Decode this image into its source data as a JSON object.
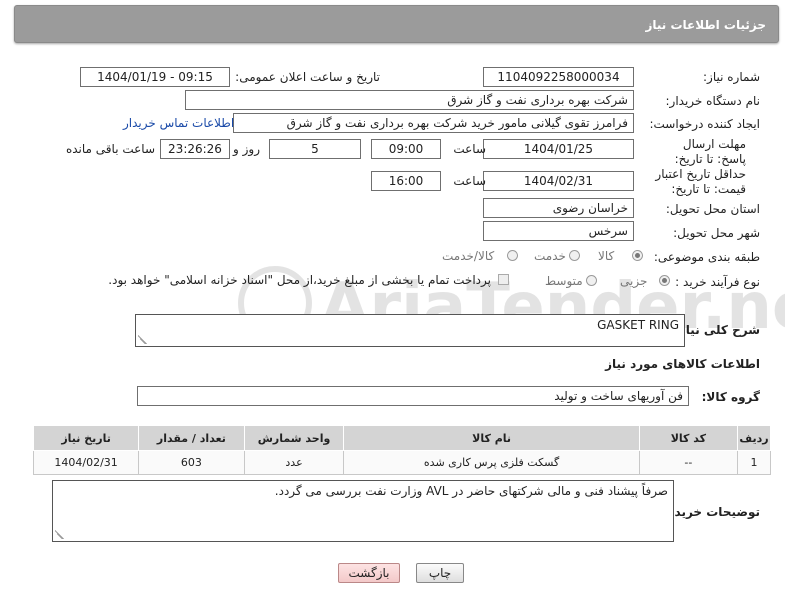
{
  "header": {
    "title": "جزئیات اطلاعات نیاز"
  },
  "form": {
    "need_number": {
      "label": "شماره نیاز:",
      "value": "1104092258000034"
    },
    "announce_datetime": {
      "label": "تاریخ و ساعت اعلان عمومی:",
      "value": "1404/01/19 - 09:15"
    },
    "buyer_org": {
      "label": "نام دستگاه خریدار:",
      "value": "شرکت بهره برداری نفت و گاز شرق"
    },
    "requester": {
      "label": "ایجاد کننده درخواست:",
      "value": "فرامرز تقوی گیلانی مامور خرید شرکت بهره برداری نفت و گاز شرق",
      "contact_link": "اطلاعات تماس خریدار"
    },
    "reply_deadline": {
      "label": "مهلت ارسال پاسخ: تا تاریخ:",
      "date": "1404/01/25",
      "time_label": "ساعت",
      "time": "09:00",
      "days": "5",
      "days_label": "روز و",
      "remaining": "23:26:26",
      "remaining_label": "ساعت باقی مانده"
    },
    "price_validity": {
      "label": "حداقل تاریخ اعتبار قیمت: تا تاریخ:",
      "date": "1404/02/31",
      "time_label": "ساعت",
      "time": "16:00"
    },
    "delivery_province": {
      "label": "استان محل تحویل:",
      "value": "خراسان رضوی"
    },
    "delivery_city": {
      "label": "شهر محل تحویل:",
      "value": "سرخس"
    },
    "category": {
      "label": "طبقه بندی موضوعی:",
      "options": [
        "کالا",
        "خدمت",
        "کالا/خدمت"
      ],
      "selected": "کالا"
    },
    "process_type": {
      "label": "نوع فرآیند خرید :",
      "options": [
        "جزیی",
        "متوسط"
      ],
      "selected": "جزیی",
      "payment_note": "پرداخت تمام یا بخشی از مبلغ خرید،از محل \"اسناد خزانه اسلامی\" خواهد بود."
    },
    "description": {
      "label": "شرح کلی نیاز:",
      "value": "GASKET RING"
    }
  },
  "items_section": {
    "title": "اطلاعات کالاهای مورد نیاز",
    "group_label": "گروه کالا:",
    "group_value": "فن آوریهای ساخت و تولید",
    "columns": [
      "ردیف",
      "کد کالا",
      "نام کالا",
      "واحد شمارش",
      "تعداد / مقدار",
      "تاریخ نیاز"
    ],
    "rows": [
      {
        "index": "1",
        "code": "--",
        "name": "گسکت فلزی پرس کاری شده",
        "unit": "عدد",
        "qty": "603",
        "date": "1404/02/31"
      }
    ]
  },
  "buyer_notes": {
    "label": "توضیحات خریدار:",
    "value": "صرفاً پیشناد فنی و مالی شرکتهای حاضر در AVL وزارت نفت بررسی می گردد."
  },
  "buttons": {
    "print": "چاپ",
    "back": "بازگشت"
  },
  "watermark": {
    "text": "AriaTender.net"
  },
  "colors": {
    "header_bg": "#9b9b9b",
    "table_header_bg": "#d4d4d4",
    "link": "#1a4aa8",
    "back_button": "#f3c9c9"
  }
}
